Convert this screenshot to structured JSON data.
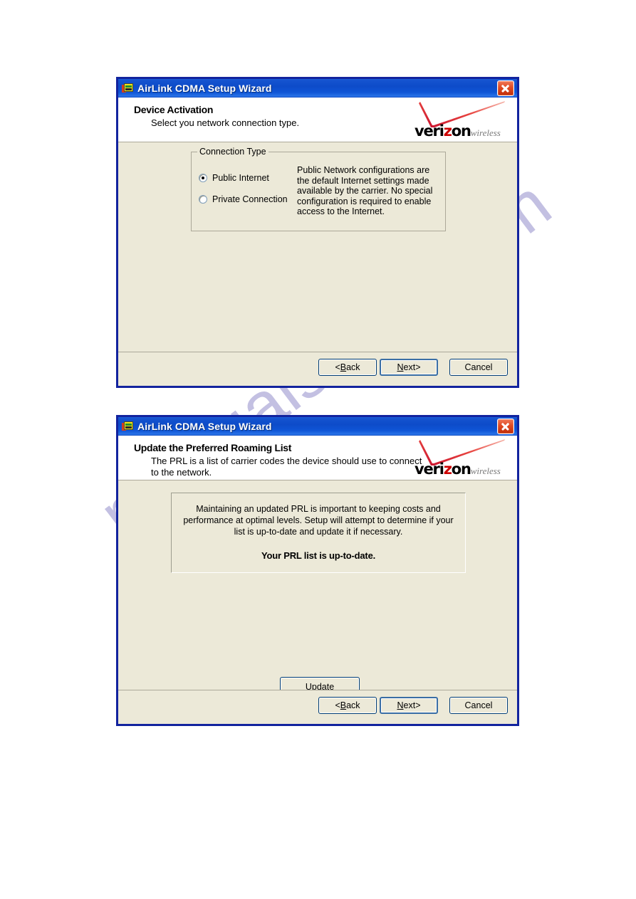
{
  "page": {
    "watermark": "manualshive.com"
  },
  "brand": {
    "logo_prefix": "veri",
    "logo_accent": "z",
    "logo_suffix": "on",
    "logo_sub": "wireless",
    "accent_color": "#cc0000"
  },
  "common": {
    "window_title": "AirLink CDMA Setup Wizard",
    "close_label": "Close",
    "buttons": {
      "back_prefix": "< ",
      "back_mnemonic": "B",
      "back_rest": "ack",
      "next_mnemonic": "N",
      "next_rest": "ext",
      "next_suffix": " >",
      "cancel": "Cancel"
    }
  },
  "dialog1": {
    "header_title": "Device Activation",
    "header_sub_line1": "Select you network connection type.",
    "group": {
      "legend": "Connection Type",
      "options": [
        {
          "label": "Public Internet",
          "selected": true
        },
        {
          "label": "Private Connection",
          "selected": false
        }
      ],
      "description": "Public Network configurations are the default Internet settings made available by the carrier. No special configuration is required to enable access to the Internet."
    }
  },
  "dialog2": {
    "header_title": "Update the Preferred Roaming List",
    "header_sub_line1": "The PRL is a list of carrier codes the device should use to connect",
    "header_sub_line2": "to the network.",
    "info": {
      "paragraph": "Maintaining an updated PRL is important to keeping costs and performance at optimal levels. Setup will attempt to determine if your list is up-to-date and update it if necessary.",
      "status": "Your PRL list is up-to-date."
    },
    "update_button": "Update"
  }
}
